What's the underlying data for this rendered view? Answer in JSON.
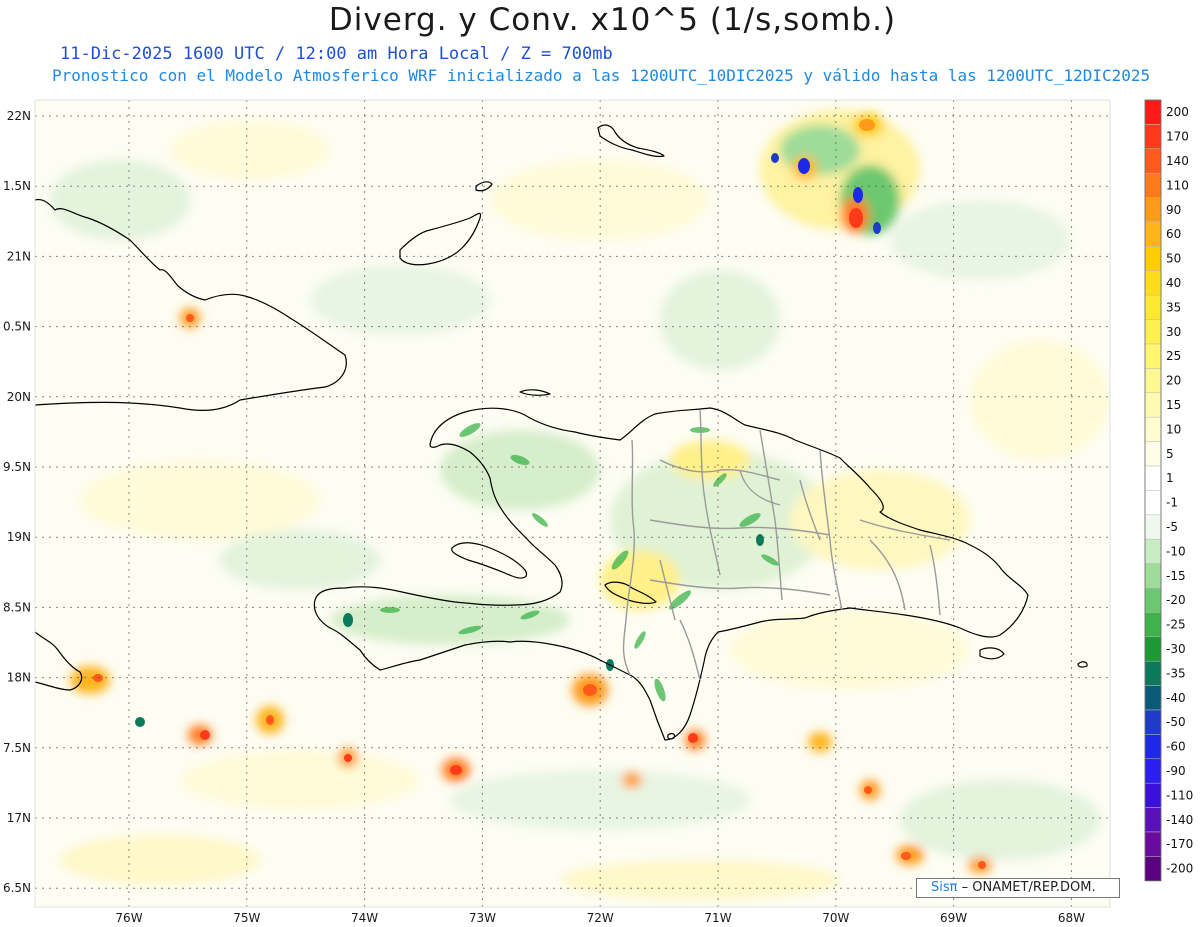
{
  "header": {
    "title": "Diverg. y Conv. x10^5 (1/s,somb.)",
    "subtitle_line1": "11-Dic-2025  1600 UTC / 12:00 am Hora Local / Z = 700mb",
    "subtitle_line2": "Pronostico con el Modelo Atmosferico WRF inicializado a las 1200UTC_10DIC2025 y válido hasta las  1200UTC_12DIC2025"
  },
  "map": {
    "lat_labels": [
      "22N",
      "1.5N",
      "21N",
      "0.5N",
      "20N",
      "9.5N",
      "19N",
      "8.5N",
      "18N",
      "7.5N",
      "17N",
      "6.5N"
    ],
    "lon_labels": [
      "76W",
      "75W",
      "74W",
      "73W",
      "72W",
      "71W",
      "70W",
      "69W",
      "68W"
    ]
  },
  "colorbar": {
    "labels": [
      "200",
      "170",
      "140",
      "110",
      "90",
      "60",
      "50",
      "40",
      "35",
      "30",
      "25",
      "20",
      "15",
      "10",
      "5",
      "1",
      "-1",
      "-5",
      "-10",
      "-15",
      "-20",
      "-25",
      "-30",
      "-35",
      "-40",
      "-50",
      "-60",
      "-90",
      "-110",
      "-140",
      "-170",
      "-200"
    ],
    "colors": [
      "#ff1a1a",
      "#ff3a1a",
      "#ff5a1a",
      "#ff7a1a",
      "#ff9a1a",
      "#ffb41a",
      "#ffcc00",
      "#ffdc1a",
      "#ffe830",
      "#fff050",
      "#fff570",
      "#fff890",
      "#fffab0",
      "#fffcd0",
      "#fffde8",
      "#ffffff",
      "#ffffff",
      "#eef8ee",
      "#c8ecc4",
      "#9edc9a",
      "#6cc870",
      "#3cb44a",
      "#1a9a32",
      "#0a7a5a",
      "#0a5a7a",
      "#1e3cc8",
      "#1e28e8",
      "#2a1ef0",
      "#3a10d8",
      "#5a10b8",
      "#6a0aa0",
      "#5a0080"
    ]
  },
  "credit": {
    "brand": "Sisπ",
    "text": "– ONAMET/REP.DOM."
  }
}
